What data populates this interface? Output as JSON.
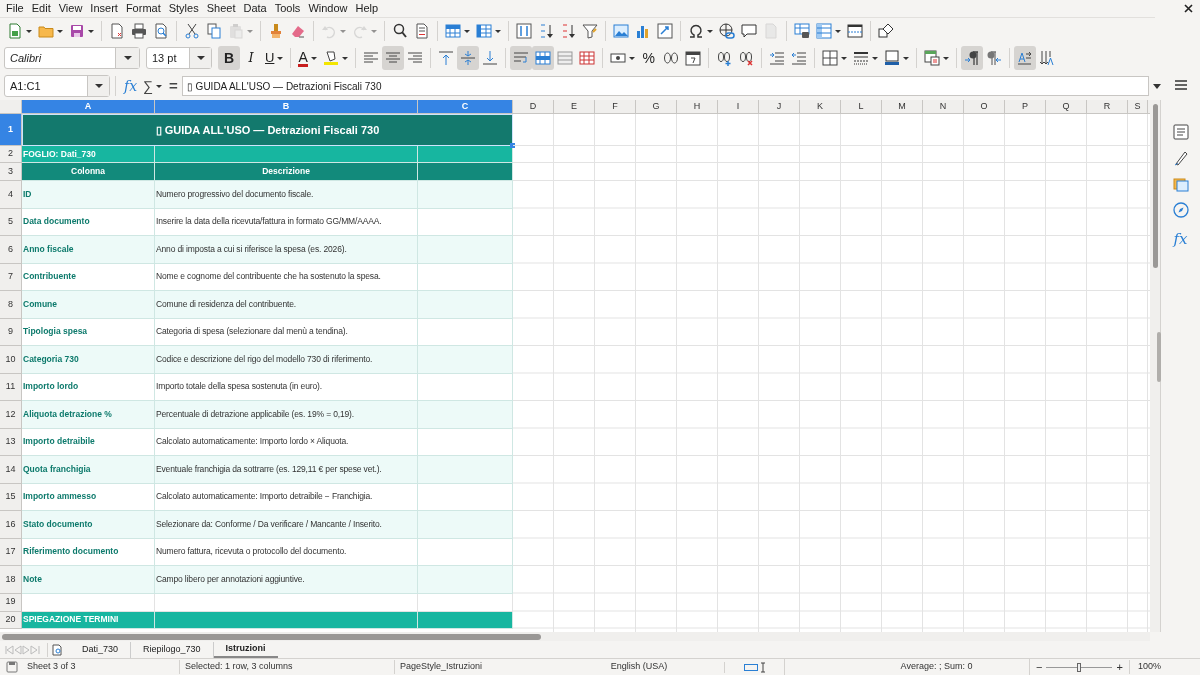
{
  "menu": [
    "File",
    "Edit",
    "View",
    "Insert",
    "Format",
    "Styles",
    "Sheet",
    "Data",
    "Tools",
    "Window",
    "Help"
  ],
  "standard_toolbar": [
    {
      "kind": "new",
      "dropdown": true,
      "disabled": false
    },
    {
      "kind": "open",
      "dropdown": true,
      "disabled": false
    },
    {
      "kind": "save",
      "dropdown": true,
      "disabled": false
    },
    {
      "kind": "sep"
    },
    {
      "kind": "pdf",
      "dropdown": false,
      "disabled": false
    },
    {
      "kind": "print",
      "dropdown": false,
      "disabled": false
    },
    {
      "kind": "preview",
      "dropdown": false,
      "disabled": false
    },
    {
      "kind": "sep"
    },
    {
      "kind": "cut",
      "dropdown": false,
      "disabled": false
    },
    {
      "kind": "copy",
      "dropdown": false,
      "disabled": false
    },
    {
      "kind": "paste",
      "dropdown": true,
      "disabled": true
    },
    {
      "kind": "sep"
    },
    {
      "kind": "clone",
      "dropdown": false,
      "disabled": false
    },
    {
      "kind": "clear",
      "dropdown": false,
      "disabled": false
    },
    {
      "kind": "sep"
    },
    {
      "kind": "undo",
      "dropdown": true,
      "disabled": true
    },
    {
      "kind": "redo",
      "dropdown": true,
      "disabled": true
    },
    {
      "kind": "sep"
    },
    {
      "kind": "find",
      "dropdown": false,
      "disabled": false
    },
    {
      "kind": "spelling",
      "dropdown": false,
      "disabled": false
    },
    {
      "kind": "sep"
    },
    {
      "kind": "rows",
      "dropdown": true,
      "disabled": false
    },
    {
      "kind": "columns",
      "dropdown": true,
      "disabled": false
    },
    {
      "kind": "sep"
    },
    {
      "kind": "sort",
      "dropdown": false,
      "disabled": false
    },
    {
      "kind": "sort_asc",
      "dropdown": false,
      "disabled": false
    },
    {
      "kind": "sort_desc",
      "dropdown": false,
      "disabled": false
    },
    {
      "kind": "filter",
      "dropdown": false,
      "disabled": false
    },
    {
      "kind": "sep"
    },
    {
      "kind": "image",
      "dropdown": false,
      "disabled": false
    },
    {
      "kind": "chart",
      "dropdown": false,
      "disabled": false
    },
    {
      "kind": "pivot",
      "dropdown": false,
      "disabled": false
    },
    {
      "kind": "sep"
    },
    {
      "kind": "special",
      "dropdown": true,
      "disabled": false
    },
    {
      "kind": "hyperlink",
      "dropdown": false,
      "disabled": false
    },
    {
      "kind": "comment",
      "dropdown": false,
      "disabled": false
    },
    {
      "kind": "headerfooter",
      "dropdown": false,
      "disabled": true
    },
    {
      "kind": "sep"
    },
    {
      "kind": "printrange",
      "dropdown": false,
      "disabled": false
    },
    {
      "kind": "freeze",
      "dropdown": true,
      "disabled": false
    },
    {
      "kind": "split",
      "dropdown": false,
      "disabled": false
    },
    {
      "kind": "sep"
    },
    {
      "kind": "shapes",
      "dropdown": false,
      "disabled": false
    }
  ],
  "format_toolbar": {
    "font_name": "Calibri",
    "font_size": "13 pt",
    "buttons": [
      {
        "kind": "bold",
        "glyph": "B",
        "on": true,
        "dropdown": false
      },
      {
        "kind": "italic",
        "glyph": "I",
        "on": false,
        "dropdown": false
      },
      {
        "kind": "underline",
        "glyph": "U",
        "on": false,
        "dropdown": true
      },
      {
        "kind": "sep"
      },
      {
        "kind": "font_color",
        "glyph": "A",
        "on": false,
        "dropdown": true
      },
      {
        "kind": "highlight",
        "on": false,
        "dropdown": true
      },
      {
        "kind": "sep"
      },
      {
        "kind": "align_left",
        "on": false,
        "dropdown": false
      },
      {
        "kind": "align_center",
        "on": true,
        "dropdown": false
      },
      {
        "kind": "align_right",
        "on": false,
        "dropdown": false
      },
      {
        "kind": "sep"
      },
      {
        "kind": "align_top",
        "on": false,
        "dropdown": false
      },
      {
        "kind": "align_middle",
        "on": true,
        "dropdown": false
      },
      {
        "kind": "align_bottom",
        "on": false,
        "dropdown": false
      },
      {
        "kind": "sep"
      },
      {
        "kind": "wrap",
        "on": true,
        "dropdown": false
      },
      {
        "kind": "merge_center",
        "on": true,
        "dropdown": false
      },
      {
        "kind": "merge",
        "on": false,
        "dropdown": false
      },
      {
        "kind": "unmerge",
        "on": false,
        "dropdown": false
      },
      {
        "kind": "sep"
      },
      {
        "kind": "currency",
        "on": false,
        "dropdown": true
      },
      {
        "kind": "percent",
        "glyph": "%",
        "on": false,
        "dropdown": false
      },
      {
        "kind": "number",
        "on": false,
        "dropdown": false
      },
      {
        "kind": "date",
        "on": false,
        "dropdown": false
      },
      {
        "kind": "sep"
      },
      {
        "kind": "add_decimal",
        "on": false,
        "dropdown": false
      },
      {
        "kind": "del_decimal",
        "on": false,
        "dropdown": false
      },
      {
        "kind": "sep"
      },
      {
        "kind": "indent",
        "on": false,
        "dropdown": false
      },
      {
        "kind": "outdent",
        "on": false,
        "dropdown": false
      },
      {
        "kind": "sep"
      },
      {
        "kind": "borders",
        "on": false,
        "dropdown": true
      },
      {
        "kind": "border_style",
        "on": false,
        "dropdown": true
      },
      {
        "kind": "border_color",
        "on": false,
        "dropdown": true
      },
      {
        "kind": "sep"
      },
      {
        "kind": "conditional",
        "on": false,
        "dropdown": true
      },
      {
        "kind": "sep"
      },
      {
        "kind": "ltr",
        "on": true,
        "dropdown": false
      },
      {
        "kind": "rtl",
        "on": false,
        "dropdown": false
      },
      {
        "kind": "sep"
      },
      {
        "kind": "text_lr",
        "on": true,
        "dropdown": false
      },
      {
        "kind": "text_tb",
        "on": false,
        "dropdown": false
      }
    ]
  },
  "formula_bar": {
    "name_box": "A1:C1",
    "wizard": "fx",
    "sum": "∑",
    "equals": "=",
    "content": "▯ GUIDA ALL'USO — Detrazioni Fiscali 730"
  },
  "sidebar": {
    "functions": "fx"
  },
  "sheet": {
    "columns": [
      {
        "label": "A",
        "selected": true
      },
      {
        "label": "B",
        "selected": true
      },
      {
        "label": "C",
        "selected": true
      },
      {
        "label": "D",
        "selected": false
      },
      {
        "label": "E",
        "selected": false
      },
      {
        "label": "F",
        "selected": false
      },
      {
        "label": "G",
        "selected": false
      },
      {
        "label": "H",
        "selected": false
      },
      {
        "label": "I",
        "selected": false
      },
      {
        "label": "J",
        "selected": false
      },
      {
        "label": "K",
        "selected": false
      },
      {
        "label": "L",
        "selected": false
      },
      {
        "label": "M",
        "selected": false
      },
      {
        "label": "N",
        "selected": false
      },
      {
        "label": "O",
        "selected": false
      },
      {
        "label": "P",
        "selected": false
      },
      {
        "label": "Q",
        "selected": false
      },
      {
        "label": "R",
        "selected": false
      },
      {
        "label": "S",
        "selected": false
      }
    ],
    "rows": [
      {
        "number": "1",
        "selected": true,
        "kind": "title",
        "cells": [
          "",
          "▯ GUIDA ALL'USO — Detrazioni Fiscali 730",
          ""
        ]
      },
      {
        "number": "2",
        "selected": false,
        "kind": "section",
        "cells": [
          "FOGLIO: Dati_730"
        ]
      },
      {
        "number": "3",
        "selected": false,
        "kind": "header",
        "cells": [
          "Colonna",
          "Descrizione"
        ]
      },
      {
        "number": "4",
        "selected": false,
        "kind": "field",
        "shaded": true,
        "cells": [
          "ID",
          "Numero progressivo del documento fiscale."
        ]
      },
      {
        "number": "5",
        "selected": false,
        "kind": "field",
        "shaded": false,
        "cells": [
          "Data documento",
          "Inserire la data della ricevuta/fattura in formato GG/MM/AAAA."
        ]
      },
      {
        "number": "6",
        "selected": false,
        "kind": "field",
        "shaded": true,
        "cells": [
          "Anno fiscale",
          "Anno di imposta a cui si riferisce la spesa (es. 2026)."
        ]
      },
      {
        "number": "7",
        "selected": false,
        "kind": "field",
        "shaded": false,
        "cells": [
          "Contribuente",
          "Nome e cognome del contribuente che ha sostenuto la spesa."
        ]
      },
      {
        "number": "8",
        "selected": false,
        "kind": "field",
        "shaded": true,
        "cells": [
          "Comune",
          "Comune di residenza del contribuente."
        ]
      },
      {
        "number": "9",
        "selected": false,
        "kind": "field",
        "shaded": false,
        "cells": [
          "Tipologia spesa",
          "Categoria di spesa (selezionare dal menù a tendina)."
        ]
      },
      {
        "number": "10",
        "selected": false,
        "kind": "field",
        "shaded": true,
        "cells": [
          "Categoria 730",
          "Codice e descrizione del rigo del modello 730 di riferimento."
        ]
      },
      {
        "number": "11",
        "selected": false,
        "kind": "field",
        "shaded": false,
        "cells": [
          "Importo lordo",
          "Importo totale della spesa sostenuta (in euro)."
        ]
      },
      {
        "number": "12",
        "selected": false,
        "kind": "field",
        "shaded": true,
        "cells": [
          "Aliquota detrazione %",
          "Percentuale di detrazione applicabile (es. 19% = 0,19)."
        ]
      },
      {
        "number": "13",
        "selected": false,
        "kind": "field",
        "shaded": false,
        "cells": [
          "Importo detraibile",
          "Calcolato automaticamente: Importo lordo × Aliquota."
        ]
      },
      {
        "number": "14",
        "selected": false,
        "kind": "field",
        "shaded": true,
        "cells": [
          "Quota franchigia",
          "Eventuale franchigia da sottrarre (es. 129,11 € per spese vet.)."
        ]
      },
      {
        "number": "15",
        "selected": false,
        "kind": "field",
        "shaded": false,
        "cells": [
          "Importo ammesso",
          "Calcolato automaticamente: Importo detraibile − Franchigia."
        ]
      },
      {
        "number": "16",
        "selected": false,
        "kind": "field",
        "shaded": true,
        "cells": [
          "Stato documento",
          "Selezionare da: Conforme / Da verificare / Mancante / Inserito."
        ]
      },
      {
        "number": "17",
        "selected": false,
        "kind": "field",
        "shaded": false,
        "cells": [
          "Riferimento documento",
          "Numero fattura, ricevuta o protocollo del documento."
        ]
      },
      {
        "number": "18",
        "selected": false,
        "kind": "field",
        "shaded": true,
        "cells": [
          "Note",
          "Campo libero per annotazioni aggiuntive."
        ]
      },
      {
        "number": "19",
        "selected": false,
        "kind": "blank",
        "cells": []
      },
      {
        "number": "20",
        "selected": false,
        "kind": "section",
        "cells": [
          "SPIEGAZIONE TERMINI"
        ]
      }
    ]
  },
  "sheet_tabs": [
    {
      "label": "Dati_730",
      "selected": false
    },
    {
      "label": "Riepilogo_730",
      "selected": false
    },
    {
      "label": "Istruzioni",
      "selected": true
    }
  ],
  "status_bar": {
    "sheet": "Sheet 3 of 3",
    "selection": "Selected: 1 row, 3 columns",
    "page_style": "PageStyle_Istruzioni",
    "language": "English (USA)",
    "summary": "Average: ; Sum: 0",
    "zoom_out": "−",
    "zoom_in": "+",
    "zoom": {
      "level": 0.5,
      "label": "100%"
    }
  }
}
